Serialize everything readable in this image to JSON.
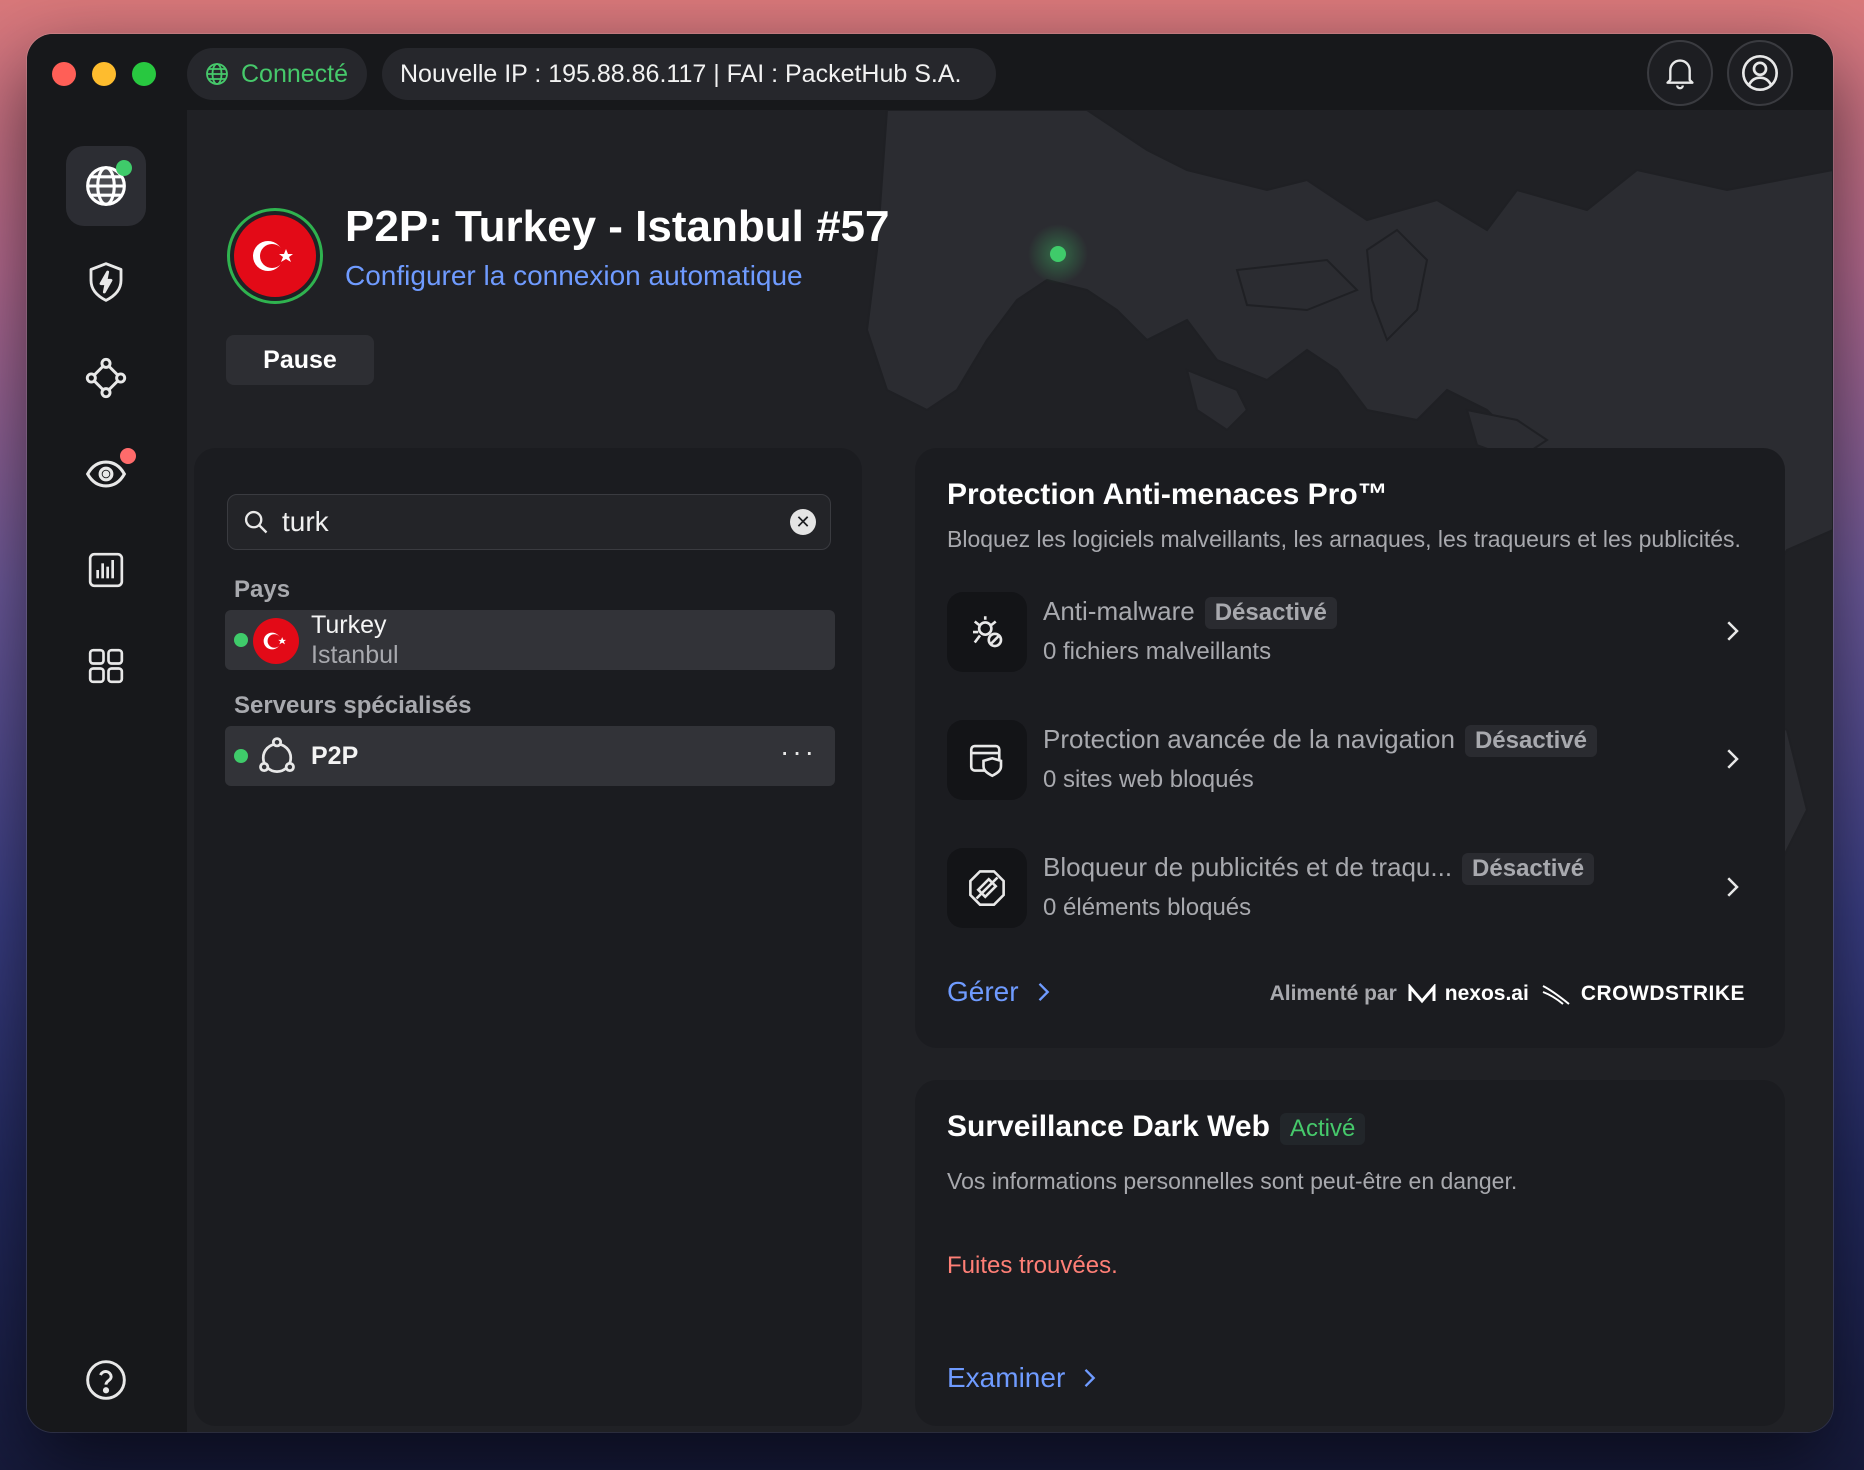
{
  "titlebar": {
    "status": "Connecté",
    "ip_info": "Nouvelle IP : 195.88.86.117 | FAI : PacketHub S.A."
  },
  "icons": {
    "globe": "globe-icon",
    "bell": "bell-icon",
    "user": "user-icon",
    "search": "search-icon",
    "clear": "clear-icon",
    "chevron": "chevron-right-icon"
  },
  "colors": {
    "accent": "#6f9bff",
    "connected": "#3fcb6a",
    "alert": "#ff7f76",
    "flag_red": "#e30a17"
  },
  "sidebar": {
    "items": [
      {
        "name": "globe-vpn",
        "icon": "globe-icon",
        "active": true
      },
      {
        "name": "threat-protection",
        "icon": "shield-bolt-icon",
        "active": false
      },
      {
        "name": "meshnet",
        "icon": "mesh-icon",
        "active": false
      },
      {
        "name": "dark-web-monitor",
        "icon": "radar-icon",
        "active": false
      },
      {
        "name": "stats",
        "icon": "chart-icon",
        "active": false
      },
      {
        "name": "apps",
        "icon": "grid-icon",
        "active": false
      },
      {
        "name": "help",
        "icon": "help-icon",
        "active": false
      }
    ]
  },
  "server": {
    "title": "P2P: Turkey - Istanbul #57",
    "auto_connect_link": "Configurer la connexion automatique",
    "pause_label": "Pause"
  },
  "search": {
    "value": "turk"
  },
  "results": {
    "countries_label": "Pays",
    "country": {
      "name": "Turkey",
      "city": "Istanbul"
    },
    "specialty_label": "Serveurs spécialisés",
    "specialty": {
      "name": "P2P",
      "more": "···"
    }
  },
  "threat": {
    "title": "Protection Anti-menaces Pro™",
    "subtitle": "Bloquez les logiciels malveillants, les arnaques, les traqueurs et les publicités.",
    "features": [
      {
        "name": "Anti-malware",
        "status": "Désactivé",
        "count": "0 fichiers malveillants",
        "icon": "bug-icon"
      },
      {
        "name": "Protection avancée de la navigation",
        "status": "Désactivé",
        "count": "0 sites web bloqués",
        "icon": "browser-shield-icon"
      },
      {
        "name": "Bloqueur de publicités et de traqu...",
        "status": "Désactivé",
        "count": "0 éléments bloqués",
        "icon": "ad-block-icon"
      }
    ],
    "manage_label": "Gérer",
    "powered_by": "Alimenté par",
    "partner1": "nexos.ai",
    "partner2": "CROWDSTRIKE"
  },
  "darkweb": {
    "title": "Surveillance Dark Web",
    "status": "Activé",
    "subtitle": "Vos informations personnelles sont peut-être en danger.",
    "alert": "Fuites trouvées.",
    "examine_label": "Examiner"
  }
}
